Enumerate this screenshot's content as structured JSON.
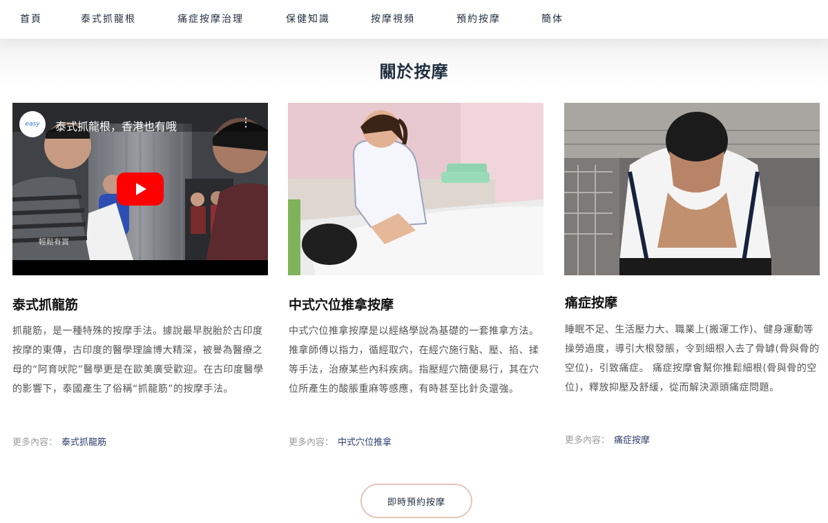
{
  "nav": {
    "items": [
      {
        "label": "首頁"
      },
      {
        "label": "泰式抓龍根"
      },
      {
        "label": "痛症按摩治理"
      },
      {
        "label": "保健知識"
      },
      {
        "label": "按摩視頻"
      },
      {
        "label": "預約按摩"
      },
      {
        "label": "簡体"
      }
    ]
  },
  "section": {
    "title": "關於按摩"
  },
  "video": {
    "title": "泰式抓龍根，香港也有哦",
    "channel_logo_text": "easy",
    "watermark": "輕鬆有賞"
  },
  "cards": [
    {
      "title": "泰式抓龍筋",
      "text": "抓龍筋，是一種特殊的按摩手法。據說最早脫胎於古印度按摩的東傳，古印度的醫學理論博大精深，被譽為醫療之母的“阿育吠陀”醫學更是在歐美廣受歡迎。在古印度醫學的影響下，泰國產生了俗稱“抓龍筋”的按摩手法。",
      "more_label": "更多內容：",
      "more_link": "泰式抓龍筋"
    },
    {
      "title": "中式穴位推拿按摩",
      "text": "中式穴位推拿按摩是以經絡學說為基礎的一套推拿方法。推拿師傅以指力，循經取穴，在經穴施行點、壓、掐、揉等手法，治療某些內科疾病。指壓經穴簡便易行，其在穴位所產生的酸脹重麻等感應，有時甚至比針灸還強。",
      "more_label": "更多內容：",
      "more_link": "中式穴位推拿"
    },
    {
      "title": "痛症按摩",
      "text": "睡眠不足、生活壓力大、職業上(搬運工作)、健身運動等操勞過度，導引大根發脹，令到細根入去了骨罅(骨與骨的空位)，引致痛症。 痛症按摩會幫你推鬆細根(骨與骨的空位)，釋放抑壓及舒緩，從而解決源頭痛症問題。",
      "more_label": "更多內容：",
      "more_link": "痛症按摩"
    }
  ],
  "cta": {
    "label": "即時預約按摩"
  },
  "colors": {
    "nav_text": "#1f2d3d",
    "link": "#2d3e6e",
    "cta_border": "#e0c5b8",
    "youtube_red": "#ff0000"
  }
}
